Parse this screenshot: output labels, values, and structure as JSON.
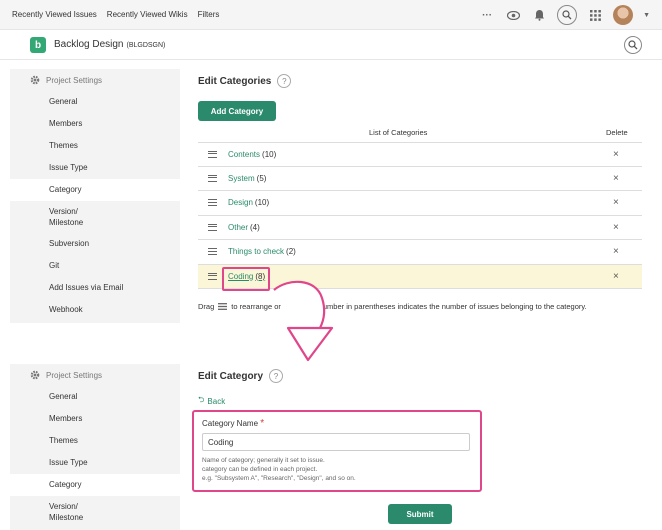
{
  "topnav": {
    "items": [
      "Recently Viewed Issues",
      "Recently Viewed Wikis",
      "Filters"
    ],
    "more": "···"
  },
  "project": {
    "logo_letter": "b",
    "name": "Backlog Design",
    "key": "(BLGDSGN)"
  },
  "sidebar_top": {
    "header": "Project Settings",
    "items": [
      "General",
      "Members",
      "Themes",
      "Issue Type",
      "Category",
      "Version/",
      "Milestone",
      "Subversion",
      "Git",
      "Add Issues via Email",
      "Webhook"
    ],
    "active": "Category"
  },
  "sidebar_bottom": {
    "header": "Project Settings",
    "items": [
      "General",
      "Members",
      "Themes",
      "Issue Type",
      "Category",
      "Version/",
      "Milestone"
    ],
    "active": "Category"
  },
  "categories_page": {
    "title": "Edit Categories",
    "help": "?",
    "add_button": "Add Category",
    "col_list": "List of Categories",
    "col_delete": "Delete",
    "rows": [
      {
        "name": "Contents",
        "count": "(10)"
      },
      {
        "name": "System",
        "count": "(5)"
      },
      {
        "name": "Design",
        "count": "(10)"
      },
      {
        "name": "Other",
        "count": "(4)"
      },
      {
        "name": "Things to check",
        "count": "(2)"
      },
      {
        "name": "Coding",
        "count": "(8)"
      }
    ],
    "delete_icon": "×",
    "note_prefix": "Drag",
    "note_suffix": "to rearrange or",
    "note_rest": "umber in parentheses indicates the number of issues belonging to the category."
  },
  "edit_page": {
    "title": "Edit Category",
    "help": "?",
    "back": "Back",
    "field_label": "Category Name",
    "required_mark": "*",
    "field_value": "Coding",
    "help_lines": [
      "Name of category; generally it set to issue.",
      "category can be defined in each project.",
      "e.g. \"Subsystem A\", \"Research\", \"Design\", and so on."
    ],
    "submit": "Submit"
  },
  "colors": {
    "accent_green": "#2a8a6b",
    "highlight_pink": "#e0468a",
    "row_highlight": "#fbf6d8"
  }
}
